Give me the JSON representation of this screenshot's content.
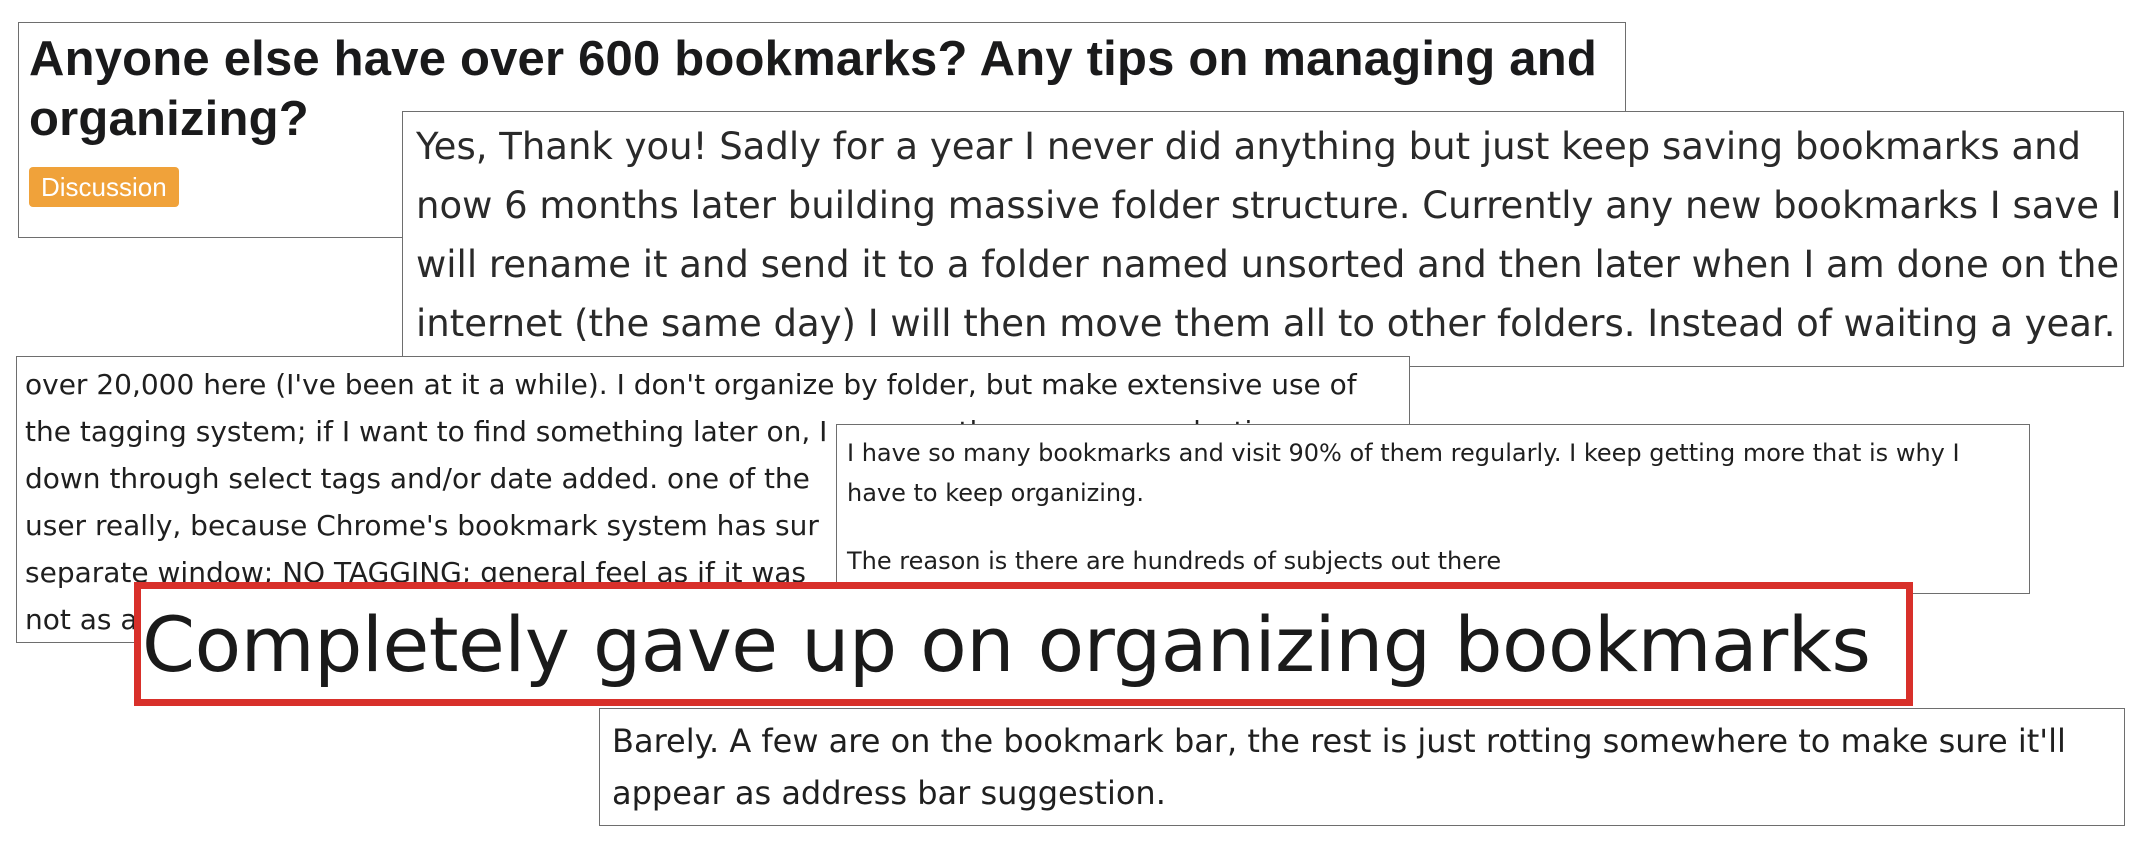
{
  "post": {
    "title": "Anyone else have over 600 bookmarks? Any tips on managing and organizing?",
    "flair": "Discussion",
    "flair_color": "#f0a23a"
  },
  "comments": {
    "yes_thank_you": {
      "lines": [
        "Yes, Thank you! Sadly for a year I never did anything but just keep saving bookmarks and",
        "now 6 months later building massive folder structure. Currently any new bookmarks I save I",
        "will rename it and send it to a folder named unsorted and then later when I am done on the",
        "internet (the same day) I will then move them all to other folders. Instead of waiting a year."
      ]
    },
    "over_20000": {
      "lines": [
        "over 20,000 here (I've been at it a while). I don't organize by folder, but make extensive use of",
        "the tagging system; if I want to find something later on, I can greatly narrow my selection",
        "down through select tags and/or date added. one of the",
        "user really, because Chrome's bookmark system has sur",
        "separate window; NO TAGGING; general feel as if it was",
        "not as a"
      ]
    },
    "so_many": {
      "lines": [
        "I have so many bookmarks and visit 90% of them regularly. I keep getting more that is why I",
        "have to keep organizing."
      ],
      "reason": "The reason is there are hundreds of subjects out there"
    },
    "barely": {
      "lines": [
        "Barely. A few are on the bookmark bar, the rest is just rotting somewhere to make sure it'll",
        "appear as address bar suggestion."
      ]
    }
  },
  "headline": {
    "text": "Completely gave up on organizing bookmarks",
    "border_color": "#d8302a"
  }
}
